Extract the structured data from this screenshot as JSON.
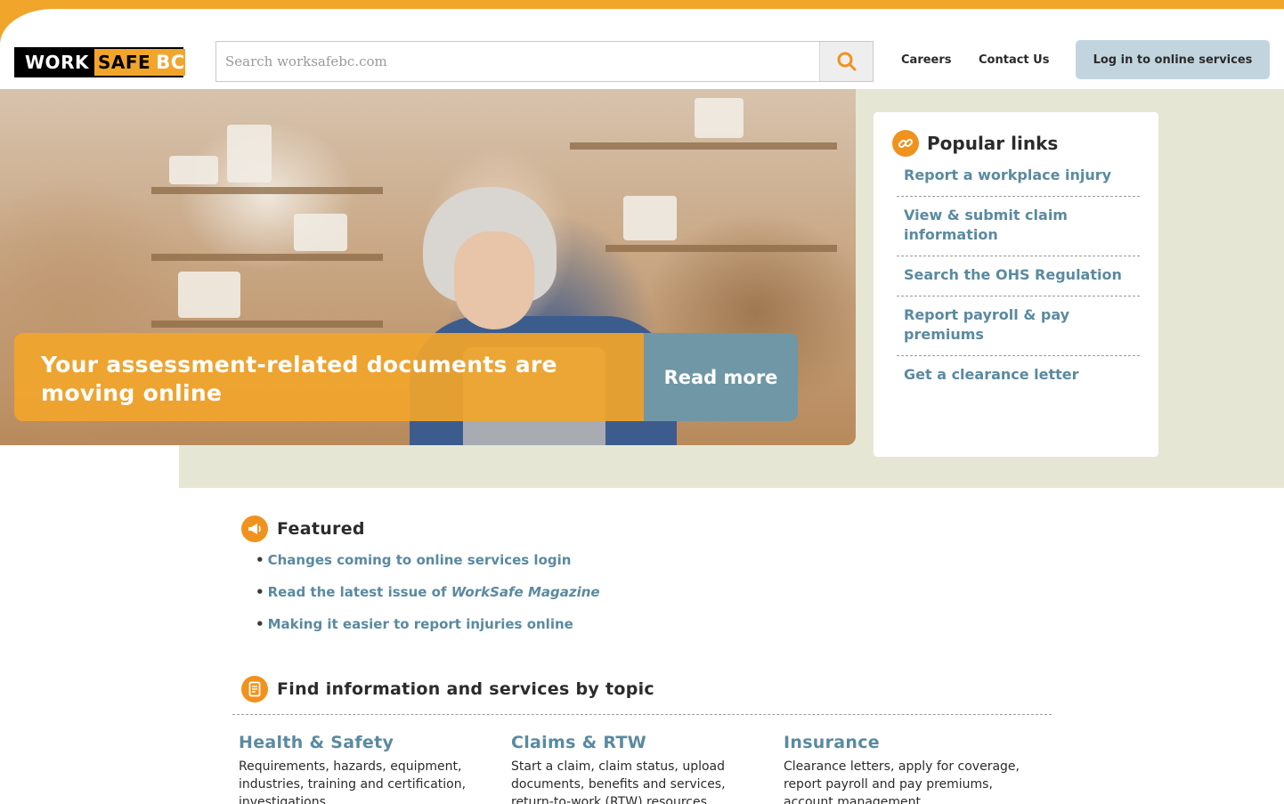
{
  "colors": {
    "brand_orange": "#f2a52b",
    "link_blue": "#5a8aa0",
    "read_more_bg": "#6f97a5",
    "login_bg": "#c2d5df",
    "beige_band": "#e6e6d4"
  },
  "header": {
    "logo": {
      "work": "WORK",
      "safe": "SAFE",
      "bc": "BC"
    },
    "search": {
      "placeholder": "Search worksafebc.com",
      "icon": "search-icon"
    },
    "nav": {
      "careers": "Careers",
      "contact": "Contact Us"
    },
    "login_label": "Log in to online services"
  },
  "hero": {
    "headline": "Your assessment-related documents are moving online",
    "cta_label": "Read more"
  },
  "popular_links": {
    "icon": "link-icon",
    "title": "Popular links",
    "items": [
      "Report a workplace injury",
      "View & submit claim information",
      "Search the OHS Regulation",
      "Report payroll & pay premiums",
      "Get a clearance letter"
    ]
  },
  "featured": {
    "icon": "megaphone-icon",
    "title": "Featured",
    "items": [
      {
        "text": "Changes coming to online services login"
      },
      {
        "text": "Read the latest issue of ",
        "italic": "WorkSafe Magazine"
      },
      {
        "text": "Making it easier to report injuries online"
      }
    ]
  },
  "topics": {
    "icon": "document-icon",
    "title": "Find information and services by topic",
    "items": [
      {
        "title": "Health & Safety",
        "desc": "Requirements, hazards, equipment, industries, training and certification, investigations"
      },
      {
        "title": "Claims & RTW",
        "desc": "Start a claim, claim status, upload documents, benefits and services, return-to-work (RTW) resources"
      },
      {
        "title": "Insurance",
        "desc": "Clearance letters, apply for coverage, report payroll and pay premiums, account management"
      }
    ]
  }
}
